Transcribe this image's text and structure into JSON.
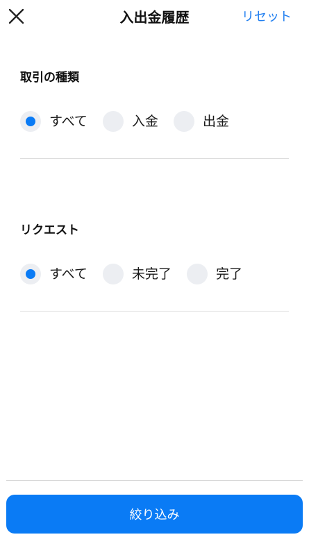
{
  "header": {
    "title": "入出金履歴",
    "reset_label": "リセット",
    "close_icon": "close-icon"
  },
  "sections": [
    {
      "title": "取引の種類",
      "options": [
        {
          "label": "すべて",
          "selected": true
        },
        {
          "label": "入金",
          "selected": false
        },
        {
          "label": "出金",
          "selected": false
        }
      ]
    },
    {
      "title": "リクエスト",
      "options": [
        {
          "label": "すべて",
          "selected": true
        },
        {
          "label": "未完了",
          "selected": false
        },
        {
          "label": "完了",
          "selected": false
        }
      ]
    }
  ],
  "footer": {
    "apply_label": "絞り込み"
  },
  "colors": {
    "accent": "#0a7bf5",
    "link": "#1f7ef0",
    "radio_unselected": "#eceef2"
  }
}
